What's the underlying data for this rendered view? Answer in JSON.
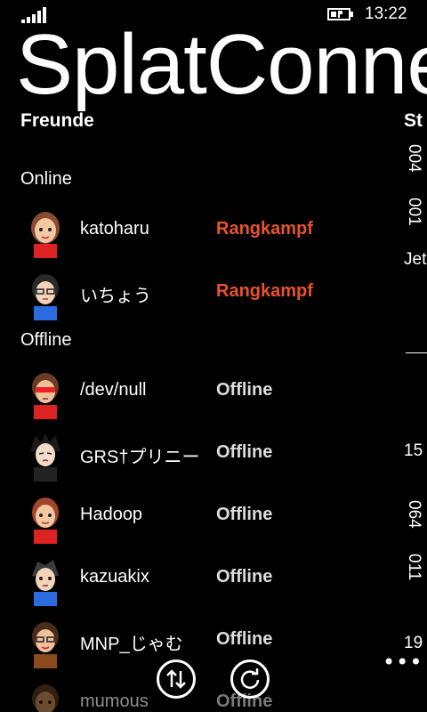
{
  "status_bar": {
    "time": "13:22",
    "signal_icon": "signal-icon",
    "battery_icon": "battery-charging-icon"
  },
  "app": {
    "title": "SplatConnect"
  },
  "pivot": {
    "active": "Freunde",
    "next": "St"
  },
  "sections": {
    "online": "Online",
    "offline": "Offline"
  },
  "friends_online": [
    {
      "name": "katoharu",
      "status": "Rangkampf",
      "avatar_color": "#8a4a32"
    },
    {
      "name": "いちょう",
      "status": "Rangkampf",
      "avatar_color": "#2a2a2a"
    }
  ],
  "friends_offline": [
    {
      "name": "/dev/null",
      "status": "Offline",
      "avatar_color": "#6b3a22"
    },
    {
      "name": "GRS†プリニー",
      "status": "Offline",
      "avatar_color": "#1a1a1a"
    },
    {
      "name": "Hadoop",
      "status": "Offline",
      "avatar_color": "#a3452a"
    },
    {
      "name": "kazuakix",
      "status": "Offline",
      "avatar_color": "#3a3a3a"
    },
    {
      "name": "MNP_じゃむ",
      "status": "Offline",
      "avatar_color": "#4a2a1a"
    },
    {
      "name": "mumous",
      "status": "Offline",
      "avatar_color": "#5a3a22"
    }
  ],
  "peek": {
    "v1": "004",
    "v2": "001",
    "v3": "Jet",
    "v4": "15",
    "v5": "064",
    "v6": "011",
    "v7": "19"
  },
  "app_bar": {
    "swap_icon": "swap-arrows-icon",
    "refresh_icon": "refresh-icon",
    "more_label": "•••"
  },
  "colors": {
    "accent": "#e8532c",
    "background": "#000000",
    "text": "#ffffff"
  }
}
